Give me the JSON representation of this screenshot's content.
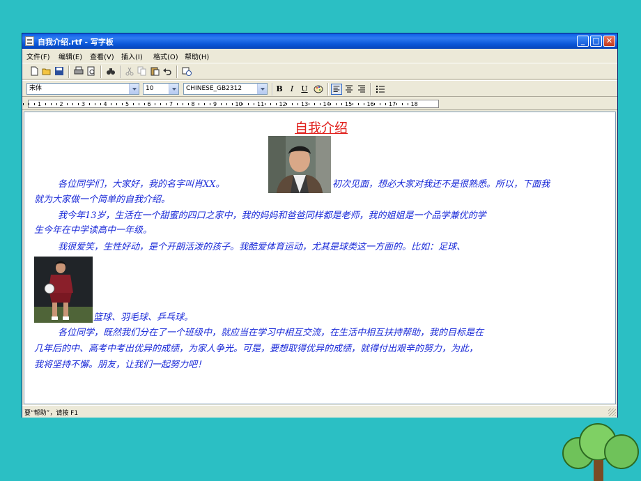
{
  "window": {
    "title": "自我介绍.rtf - 写字板",
    "buttons": {
      "minimize": "_",
      "maximize": "□",
      "close": "✕"
    }
  },
  "menu": [
    "文件(F)",
    "编辑(E)",
    "查看(V)",
    "插入(I)",
    "格式(O)",
    "帮助(H)"
  ],
  "format": {
    "font": "宋体",
    "size": "10",
    "script": "CHINESE_GB2312",
    "bold": "B",
    "italic": "I",
    "underline": "U"
  },
  "ruler": [
    "1",
    "2",
    "3",
    "4",
    "5",
    "6",
    "7",
    "8",
    "9",
    "10",
    "11",
    "12",
    "13",
    "14",
    "15",
    "16",
    "17",
    "18"
  ],
  "document": {
    "title": "自我介绍",
    "lines": [
      "各位同学们，大家好，我的名字叫肖XX。",
      "初次见面，想必大家对我还不是很熟悉。所以，下面我",
      "就为大家做一个简单的自我介绍。",
      "我今年13岁，生活在一个甜蜜的四口之家中，我的妈妈和爸爸同样都是老师，我的姐姐是一个品学兼优的学",
      "生今年在中学读高中一年级。",
      "我很爱笑，生性好动，是个开朗活泼的孩子。我酷爱体育运动，尤其是球类这一方面的。比如：足球、",
      "篮球、羽毛球、乒乓球。",
      "各位同学，既然我们分在了一个班级中，就应当在学习中相互交流，在生活中相互扶持帮助，我的目标是在",
      "几年后的中、高考中考出优异的成绩，为家人争光。可是，要想取得优异的成绩，就得付出艰辛的努力，为此，",
      "我将坚持不懈。朋友，让我们一起努力吧！"
    ]
  },
  "status": "要“帮助”，请按 F1",
  "colors": {
    "background": "#2bbfc4",
    "text": "#1a2ad8",
    "title": "#e0201c"
  }
}
